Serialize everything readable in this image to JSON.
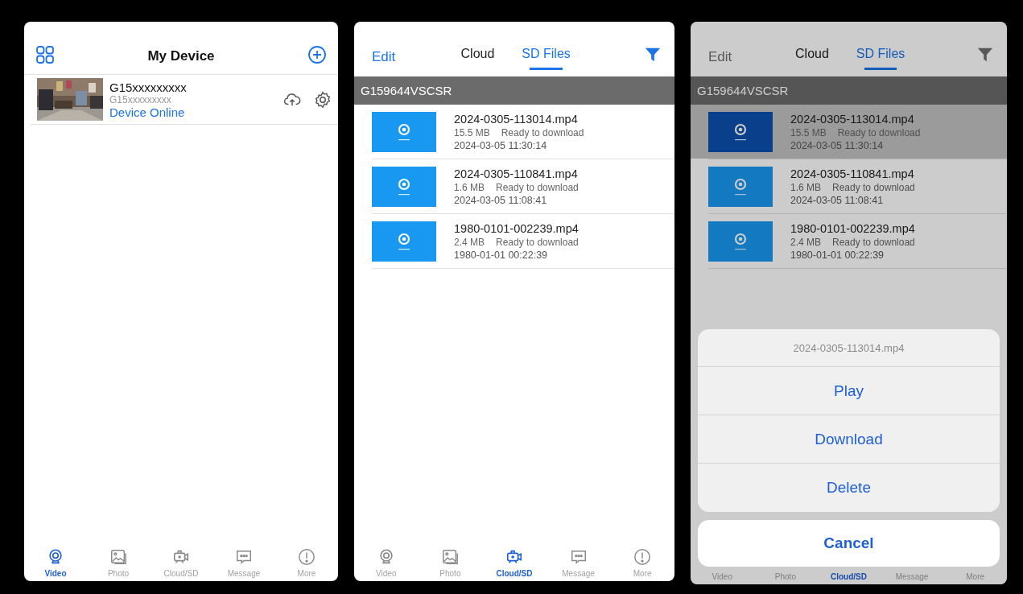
{
  "screens": [
    {
      "kind": "devices",
      "title": "My Device",
      "devices": [
        {
          "name": "G15xxxxxxxxx",
          "id": "G15xxxxxxxxx",
          "status": "Device Online"
        }
      ],
      "tabbar": [
        {
          "label": "Video",
          "selected": true
        },
        {
          "label": "Photo",
          "selected": false
        },
        {
          "label": "Cloud/SD",
          "selected": false
        },
        {
          "label": "Message",
          "selected": false
        },
        {
          "label": "More",
          "selected": false
        }
      ]
    },
    {
      "kind": "files",
      "dimmed": false,
      "edit": "Edit",
      "tabs": [
        {
          "label": "Cloud",
          "selected": false
        },
        {
          "label": "SD Files",
          "selected": true
        }
      ],
      "device_id": "G159644VSCSR",
      "files": [
        {
          "name": "2024-0305-113014.mp4",
          "size": "15.5 MB",
          "status": "Ready to download",
          "date": "2024-03-05 11:30:14",
          "selected": false
        },
        {
          "name": "2024-0305-110841.mp4",
          "size": "1.6 MB",
          "status": "Ready to download",
          "date": "2024-03-05 11:08:41",
          "selected": false
        },
        {
          "name": "1980-0101-002239.mp4",
          "size": "2.4 MB",
          "status": "Ready to download",
          "date": "1980-01-01 00:22:39",
          "selected": false
        }
      ],
      "tabbar": [
        {
          "label": "Video",
          "selected": false
        },
        {
          "label": "Photo",
          "selected": false
        },
        {
          "label": "Cloud/SD",
          "selected": true
        },
        {
          "label": "Message",
          "selected": false
        },
        {
          "label": "More",
          "selected": false
        }
      ]
    },
    {
      "kind": "files",
      "dimmed": true,
      "edit": "Edit",
      "tabs": [
        {
          "label": "Cloud",
          "selected": false
        },
        {
          "label": "SD Files",
          "selected": true
        }
      ],
      "device_id": "G159644VSCSR",
      "files": [
        {
          "name": "2024-0305-113014.mp4",
          "size": "15.5 MB",
          "status": "Ready to download",
          "date": "2024-03-05 11:30:14",
          "selected": true
        },
        {
          "name": "2024-0305-110841.mp4",
          "size": "1.6 MB",
          "status": "Ready to download",
          "date": "2024-03-05 11:08:41",
          "selected": false
        },
        {
          "name": "1980-0101-002239.mp4",
          "size": "2.4 MB",
          "status": "Ready to download",
          "date": "1980-01-01 00:22:39",
          "selected": false
        }
      ],
      "tabbar": [
        {
          "label": "Video",
          "selected": false
        },
        {
          "label": "Photo",
          "selected": false
        },
        {
          "label": "Cloud/SD",
          "selected": true
        },
        {
          "label": "Message",
          "selected": false
        },
        {
          "label": "More",
          "selected": false
        }
      ],
      "action_sheet": {
        "title": "2024-0305-113014.mp4",
        "actions": [
          "Play",
          "Download",
          "Delete"
        ],
        "cancel": "Cancel"
      }
    }
  ]
}
